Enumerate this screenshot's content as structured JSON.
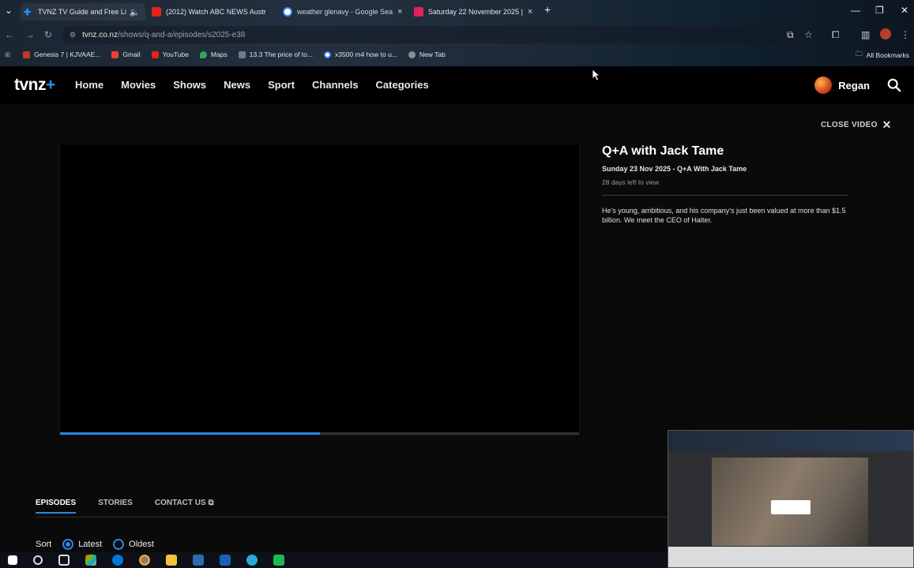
{
  "browser": {
    "tabs": [
      {
        "title": "TVNZ TV Guide and Free Li",
        "active": true,
        "icon": "tvnz-icon",
        "color": "#1f8fff"
      },
      {
        "title": "(2012) Watch ABC NEWS Austr",
        "active": false,
        "icon": "youtube-icon",
        "color": "#e62117"
      },
      {
        "title": "weather glenavy - Google Sea",
        "active": false,
        "icon": "google-icon",
        "color": "#4285f4"
      },
      {
        "title": "Saturday 22 November 2025 |",
        "active": false,
        "icon": "play-icon",
        "color": "#e2245a"
      }
    ],
    "url_host": "tvnz.co.nz",
    "url_path": "/shows/q-and-a/episodes/s2025-e38",
    "bookmarks": [
      {
        "label": "Genesis 7 | KJVAAE...",
        "icon": "bookmark-red-icon",
        "color": "#c0392b"
      },
      {
        "label": "Gmail",
        "icon": "gmail-icon",
        "color": "#ea4335"
      },
      {
        "label": "YouTube",
        "icon": "youtube-icon",
        "color": "#e62117"
      },
      {
        "label": "Maps",
        "icon": "maps-icon",
        "color": "#34a853"
      },
      {
        "label": "13.3 The price of to...",
        "icon": "bookmark-icon",
        "color": "#6a7b8c"
      },
      {
        "label": "x3500 m4 how to u...",
        "icon": "google-icon",
        "color": "#4285f4"
      },
      {
        "label": "New Tab",
        "icon": "chrome-icon",
        "color": "#8a8f96"
      }
    ],
    "all_bookmarks": "All Bookmarks"
  },
  "site": {
    "logo": "tvnz",
    "logo_plus": "+",
    "nav": [
      "Home",
      "Movies",
      "Shows",
      "News",
      "Sport",
      "Channels",
      "Categories"
    ],
    "user": "Regan"
  },
  "video": {
    "close_label": "CLOSE VIDEO",
    "progress": 0.5
  },
  "episode": {
    "title": "Q+A with Jack Tame",
    "subtitle": "Sunday 23 Nov 2025 - Q+A With Jack Tame",
    "days_left": "28 days left to view",
    "description": "He's young, ambitious, and his company's just been valued at more than $1.5 billion. We meet the CEO of Halter."
  },
  "subtabs": {
    "episodes": "EPISODES",
    "stories": "STORIES",
    "contact": "CONTACT US"
  },
  "sort": {
    "label": "Sort",
    "latest": "Latest",
    "oldest": "Oldest",
    "selected": "Latest"
  },
  "colors": {
    "accent": "#2b86e0",
    "background": "#0a0a0a"
  }
}
